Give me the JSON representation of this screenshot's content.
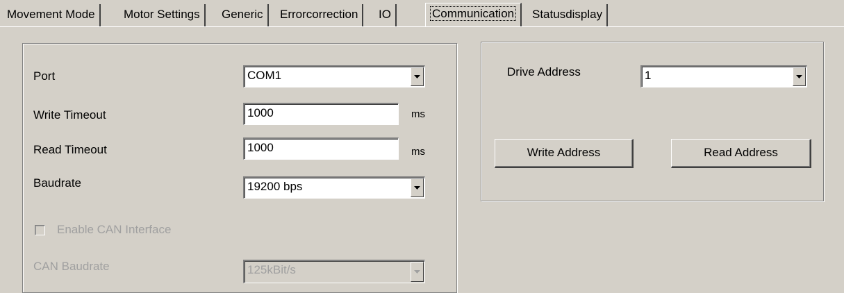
{
  "tabs": [
    {
      "label": "Movement Mode"
    },
    {
      "label": "Motor Settings"
    },
    {
      "label": "Generic"
    },
    {
      "label": "Errorcorrection"
    },
    {
      "label": "IO"
    },
    {
      "label": "Communication"
    },
    {
      "label": "Statusdisplay"
    }
  ],
  "active_tab": "Communication",
  "serial": {
    "port_label": "Port",
    "port_value": "COM1",
    "write_timeout_label": "Write Timeout",
    "write_timeout_value": "1000",
    "write_timeout_unit": "ms",
    "read_timeout_label": "Read Timeout",
    "read_timeout_value": "1000",
    "read_timeout_unit": "ms",
    "baudrate_label": "Baudrate",
    "baudrate_value": "19200 bps",
    "can_enable_label": "Enable CAN Interface",
    "can_enable_checked": false,
    "can_baudrate_label": "CAN Baudrate",
    "can_baudrate_value": "125kBit/s"
  },
  "drive": {
    "address_label": "Drive Address",
    "address_value": "1",
    "write_button": "Write Address",
    "read_button": "Read Address"
  },
  "icons": {
    "dropdown": "chevron-down-icon"
  }
}
